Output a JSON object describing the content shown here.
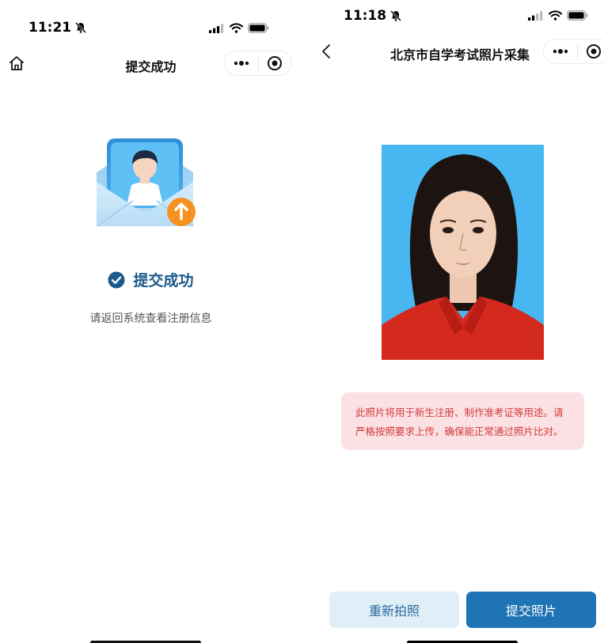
{
  "left_screen": {
    "status_bar": {
      "time": "11:21"
    },
    "navbar": {
      "title": "提交成功"
    },
    "content": {
      "success_title": "提交成功",
      "success_subtitle": "请返回系统查看注册信息"
    }
  },
  "right_screen": {
    "status_bar": {
      "time": "11:18"
    },
    "navbar": {
      "title": "北京市自学考试照片采集"
    },
    "notice": {
      "line1": "此照片将用于新生注册、制作准考证等用途。请",
      "line2": "严格按照要求上传，确保能正常通过照片比对。"
    },
    "buttons": {
      "retake": "重新拍照",
      "submit": "提交照片"
    }
  },
  "colors": {
    "accent": "#1f74b5",
    "success_check": "#1b5a8c",
    "notice_bg": "#fbe1e3",
    "notice_text": "#d33a3a",
    "photo_bg": "#47b6f1"
  },
  "icons": [
    "home-icon",
    "back-chevron-icon",
    "more-dots-icon",
    "close-target-icon",
    "check-circle-icon",
    "upload-arrow-icon",
    "bell-off-icon",
    "signal-icon",
    "wifi-icon",
    "battery-icon"
  ]
}
